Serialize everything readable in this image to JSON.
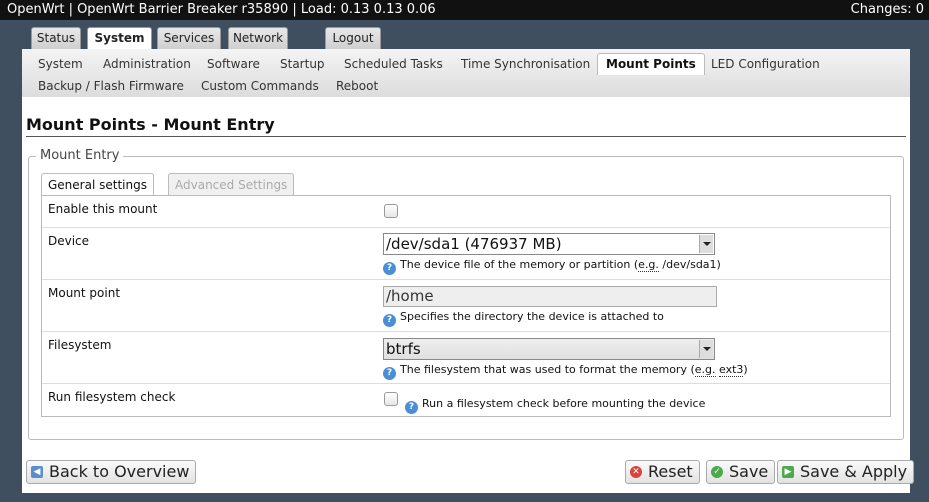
{
  "header": {
    "title": "OpenWrt | OpenWrt Barrier Breaker r35890 | Load: 0.13 0.13 0.06",
    "changes": "Changes: 0"
  },
  "main_tabs": [
    "Status",
    "System",
    "Services",
    "Network",
    "Logout"
  ],
  "sub_tabs": [
    "System",
    "Administration",
    "Software",
    "Startup",
    "Scheduled Tasks",
    "Time Synchronisation",
    "Mount Points",
    "LED Configuration",
    "Backup / Flash Firmware",
    "Custom Commands",
    "Reboot"
  ],
  "page": {
    "title": "Mount Points - Mount Entry",
    "legend": "Mount Entry"
  },
  "section_tabs": [
    "General settings",
    "Advanced Settings"
  ],
  "form": {
    "enable": {
      "label": "Enable this mount",
      "checked": false
    },
    "device": {
      "label": "Device",
      "value": "/dev/sda1 (476937 MB)",
      "help_pre": "The device file of the memory or partition (",
      "help_eg": "e.g.",
      "help_post": " /dev/sda1)"
    },
    "mount_point": {
      "label": "Mount point",
      "value": "/home",
      "help": "Specifies the directory the device is attached to"
    },
    "filesystem": {
      "label": "Filesystem",
      "value": "btrfs",
      "help_pre": "The filesystem that was used to format the memory (",
      "help_eg": "e.g.",
      "help_code": "ext3",
      "help_post": ")"
    },
    "fsck": {
      "label": "Run filesystem check",
      "checked": false,
      "help": "Run a filesystem check before mounting the device"
    }
  },
  "buttons": {
    "back": "Back to Overview",
    "reset": "Reset",
    "save": "Save",
    "save_apply": "Save & Apply"
  },
  "colors": {
    "background": "#3f4f5f",
    "header": "#111111",
    "help_icon": "#4a8fd6"
  }
}
